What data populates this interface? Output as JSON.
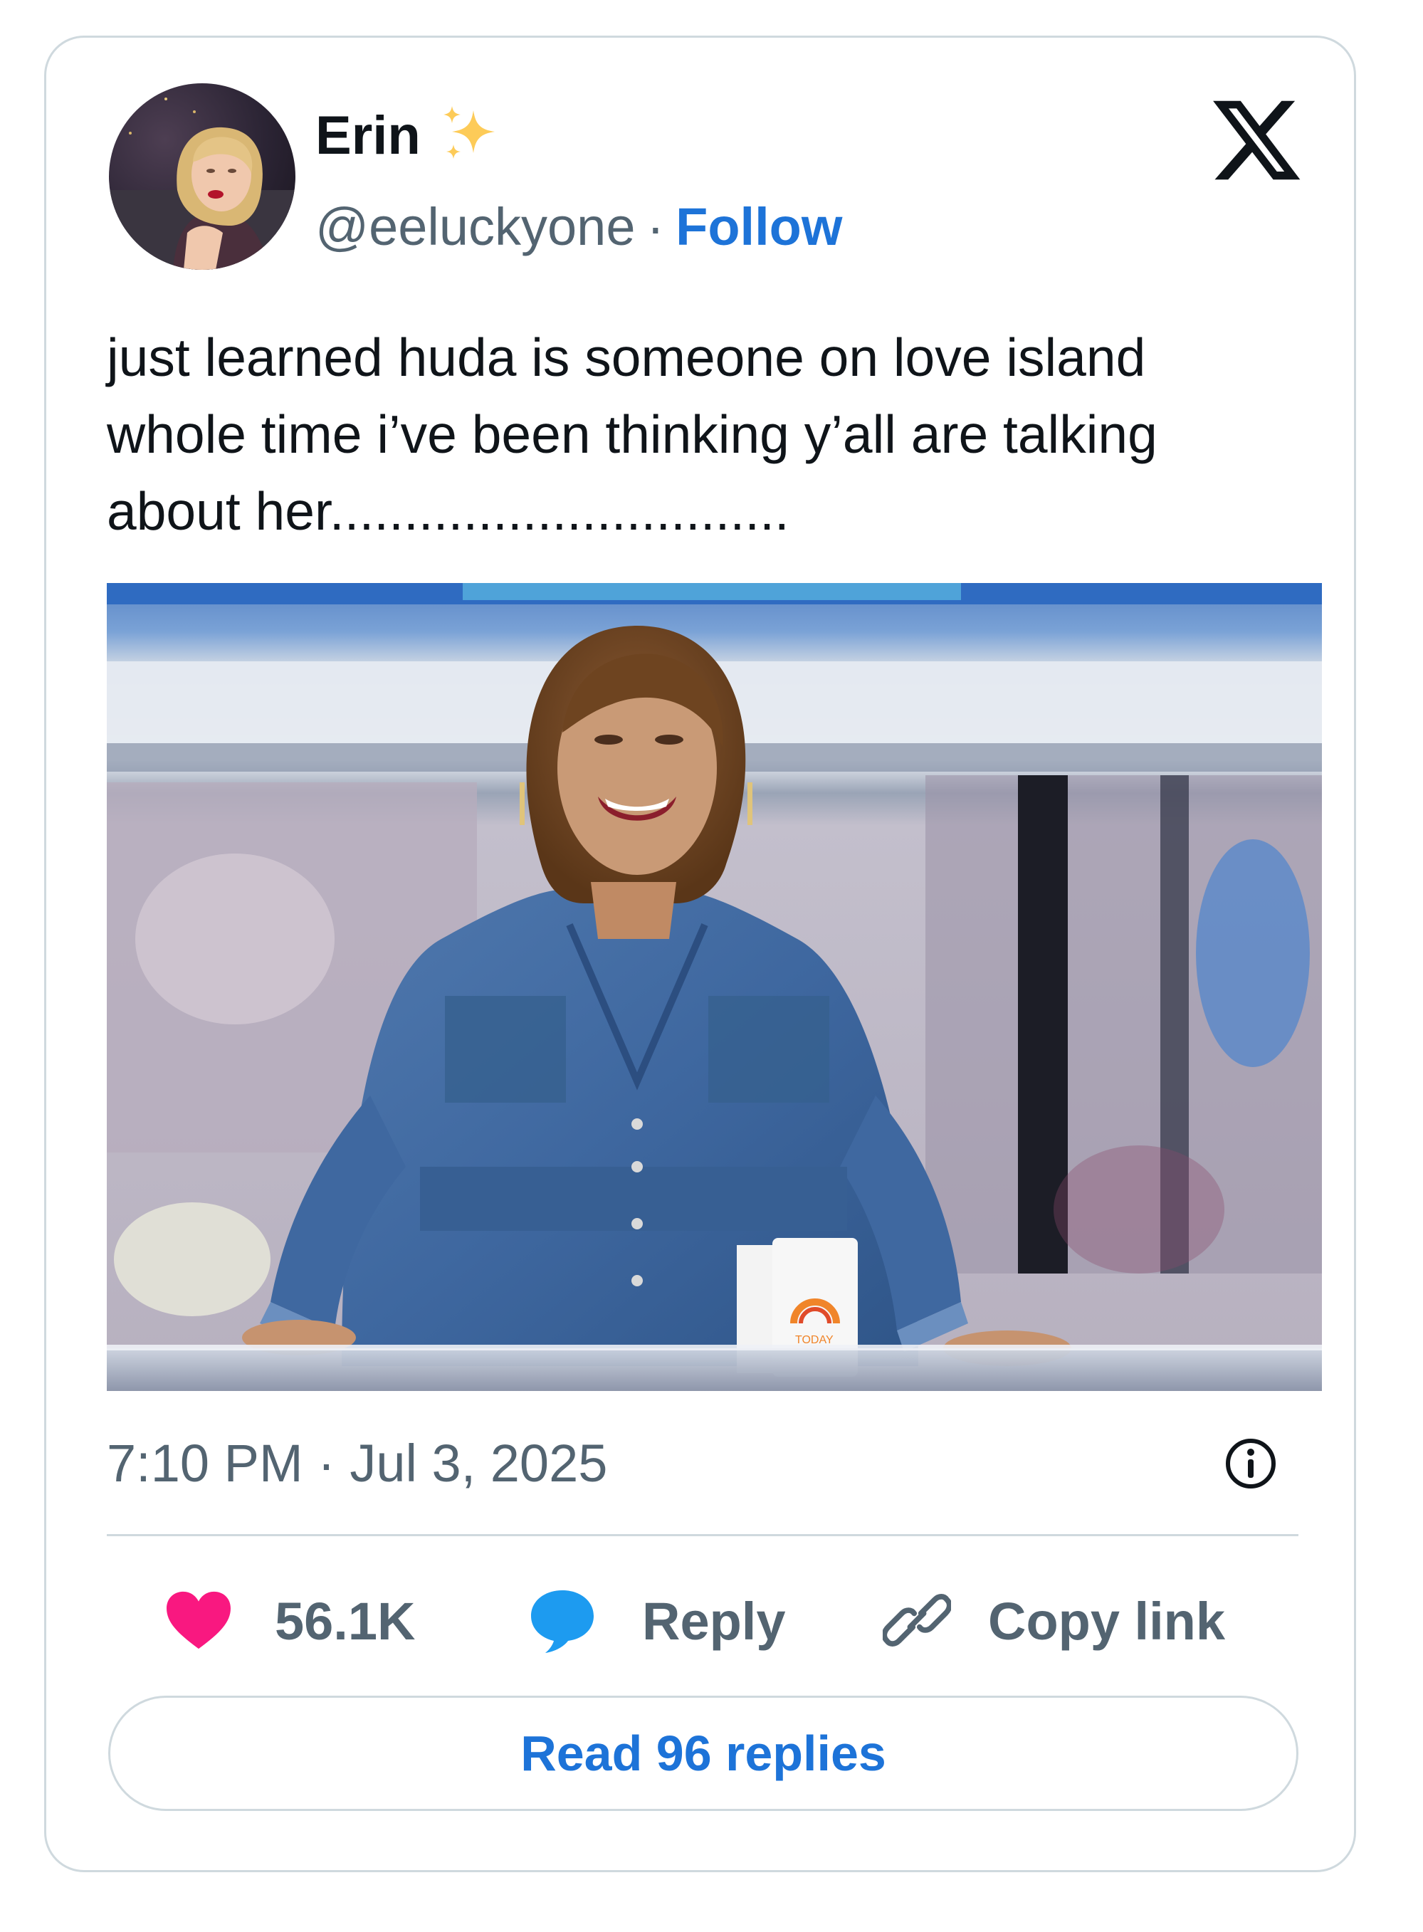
{
  "brand": {
    "accent": "#1d73d8",
    "text_primary": "#0f1419",
    "text_secondary": "#536471",
    "border": "#cfd9de",
    "like_color": "#f91880"
  },
  "author": {
    "display_name": "Erin",
    "name_emoji_icon": "sparkles-icon",
    "handle": "@eeluckyone",
    "separator": "·",
    "follow_label": "Follow",
    "avatar_icon": "avatar-photo"
  },
  "platform_logo_icon": "x-logo-icon",
  "tweet": {
    "text": "just learned huda is someone on love island\nwhole time i’ve been thinking y’all are talking\nabout her...............................",
    "media_icon": "tweet-photo",
    "media_text": "TODAY",
    "timestamp": "7:10 PM · Jul 3, 2025",
    "info_icon": "info-icon"
  },
  "actions": {
    "like_count": "56.1K",
    "like_icon": "heart-icon",
    "reply_label": "Reply",
    "reply_icon": "speech-bubble-icon",
    "copy_label": "Copy link",
    "copy_icon": "link-icon"
  },
  "read_replies_label": "Read 96 replies"
}
